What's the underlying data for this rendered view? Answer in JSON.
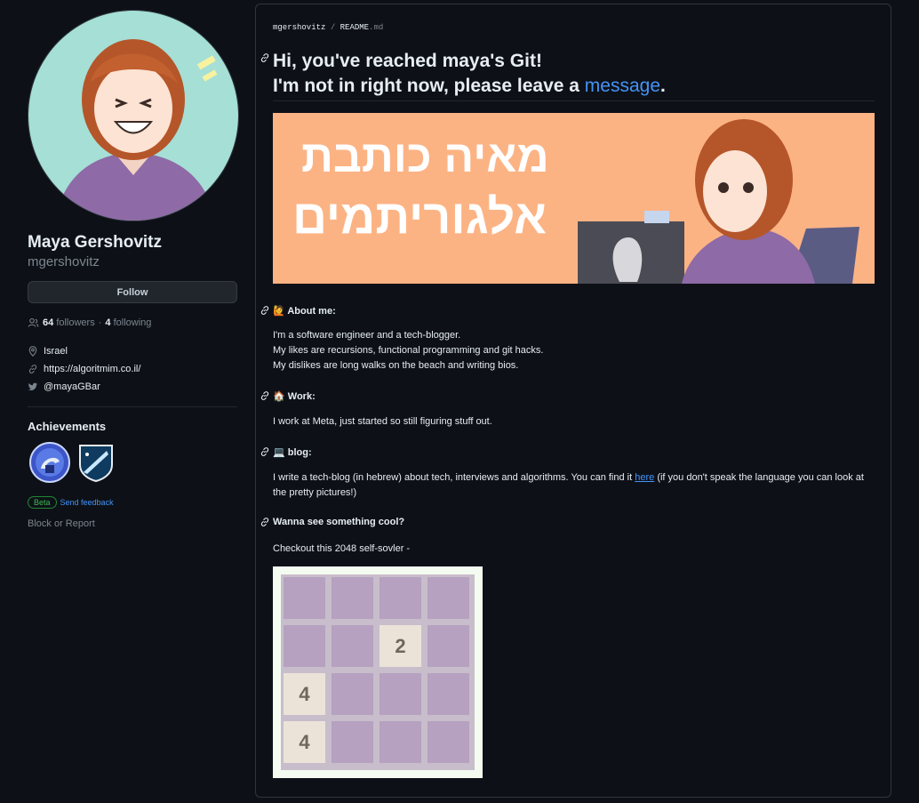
{
  "profile": {
    "name": "Maya Gershovitz",
    "login": "mgershovitz",
    "follow_label": "Follow",
    "followers_count": "64",
    "followers_label": "followers",
    "dot": "·",
    "following_count": "4",
    "following_label": "following",
    "location": "Israel",
    "website": "https://algoritmim.co.il/",
    "twitter": "@mayaGBar"
  },
  "achievements": {
    "title": "Achievements",
    "beta_label": "Beta",
    "feedback_label": "Send feedback"
  },
  "block_label": "Block or Report",
  "readme": {
    "breadcrumb_user": "mgershovitz",
    "breadcrumb_sep": "/",
    "breadcrumb_file": "README",
    "breadcrumb_ext": ".md",
    "title_line1": "Hi, you've reached maya's Git!",
    "title_line2_pre": "I'm not in right now, please leave a ",
    "title_line2_link": "message",
    "title_line2_post": ".",
    "banner_text_line1": "מאיה כותבת",
    "banner_text_line2": "אלגוריתמים",
    "sections": [
      {
        "emoji": "🙋",
        "heading": "About me:",
        "lines": [
          "I'm a software engineer and a tech-blogger.",
          "My likes are recursions, functional programming and git hacks.",
          "My dislikes are long walks on the beach and writing bios."
        ]
      },
      {
        "emoji": "🏠",
        "heading": "Work:",
        "lines": [
          "I work at Meta, just started so still figuring stuff out."
        ]
      },
      {
        "emoji": "💻",
        "heading": "blog:",
        "text_pre": "I write a tech-blog (in hebrew) about tech, interviews and algorithms. You can find it ",
        "link": "here",
        "text_post": " (if you don't speak the language you can look at the pretty pictures!)"
      },
      {
        "heading": "Wanna see something cool?",
        "lines": [
          "Checkout this 2048 self-sovler -"
        ]
      }
    ],
    "game_tiles": [
      [
        "",
        "",
        "",
        ""
      ],
      [
        "",
        "",
        "2",
        ""
      ],
      [
        "4",
        "",
        "",
        ""
      ],
      [
        "4",
        "",
        "",
        ""
      ]
    ]
  },
  "icons": {
    "people": "people-icon",
    "location": "location-pin-icon",
    "link": "link-icon",
    "twitter": "twitter-bird-icon",
    "anchor": "anchor-link-icon"
  },
  "colors": {
    "background": "#0d1117",
    "accent": "#4493f8",
    "banner": "#fcb384",
    "game_bg": "#c8bdcb"
  }
}
